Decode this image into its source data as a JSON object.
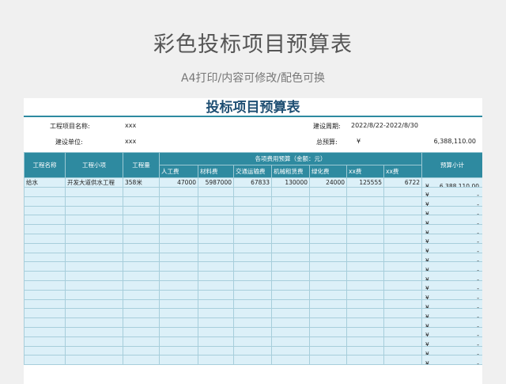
{
  "header": {
    "title": "彩色投标项目预算表",
    "subtitle": "A4打印/内容可修改/配色可换"
  },
  "sheet": {
    "title": "投标项目预算表",
    "info": {
      "project_name_label": "工程项目名称:",
      "project_name_value": "xxx",
      "period_label": "建设周期:",
      "period_value": "2022/8/22-2022/8/30",
      "unit_label": "建设单位:",
      "unit_value": "xxx",
      "total_label": "总预算:",
      "total_currency": "¥",
      "total_value": "6,388,110.00"
    },
    "table": {
      "headers": {
        "name": "工程名称",
        "item": "工程小项",
        "qty": "工程量",
        "group": "各项费用预算（金额：元）",
        "subtotal": "预算小计"
      },
      "cost_columns": [
        "人工费",
        "材料费",
        "交通运输费",
        "机械租赁费",
        "绿化费",
        "xx费",
        "xx费"
      ],
      "rows": [
        {
          "name": "给水",
          "item": "开发大道供水工程",
          "qty": "358米",
          "costs": [
            "47000",
            "5987000",
            "67833",
            "130000",
            "24000",
            "125555",
            "6722"
          ],
          "currency": "¥",
          "subtotal": "6,388,110.00"
        },
        {
          "name": "",
          "item": "",
          "qty": "",
          "costs": [
            "",
            "",
            "",
            "",
            "",
            "",
            ""
          ],
          "currency": "¥",
          "subtotal": "-"
        },
        {
          "name": "",
          "item": "",
          "qty": "",
          "costs": [
            "",
            "",
            "",
            "",
            "",
            "",
            ""
          ],
          "currency": "¥",
          "subtotal": "-"
        },
        {
          "name": "",
          "item": "",
          "qty": "",
          "costs": [
            "",
            "",
            "",
            "",
            "",
            "",
            ""
          ],
          "currency": "¥",
          "subtotal": "-"
        },
        {
          "name": "",
          "item": "",
          "qty": "",
          "costs": [
            "",
            "",
            "",
            "",
            "",
            "",
            ""
          ],
          "currency": "¥",
          "subtotal": "-"
        },
        {
          "name": "",
          "item": "",
          "qty": "",
          "costs": [
            "",
            "",
            "",
            "",
            "",
            "",
            ""
          ],
          "currency": "¥",
          "subtotal": "-"
        },
        {
          "name": "",
          "item": "",
          "qty": "",
          "costs": [
            "",
            "",
            "",
            "",
            "",
            "",
            ""
          ],
          "currency": "¥",
          "subtotal": "-"
        },
        {
          "name": "",
          "item": "",
          "qty": "",
          "costs": [
            "",
            "",
            "",
            "",
            "",
            "",
            ""
          ],
          "currency": "¥",
          "subtotal": "-"
        },
        {
          "name": "",
          "item": "",
          "qty": "",
          "costs": [
            "",
            "",
            "",
            "",
            "",
            "",
            ""
          ],
          "currency": "¥",
          "subtotal": "-"
        },
        {
          "name": "",
          "item": "",
          "qty": "",
          "costs": [
            "",
            "",
            "",
            "",
            "",
            "",
            ""
          ],
          "currency": "¥",
          "subtotal": "-"
        },
        {
          "name": "",
          "item": "",
          "qty": "",
          "costs": [
            "",
            "",
            "",
            "",
            "",
            "",
            ""
          ],
          "currency": "¥",
          "subtotal": "-"
        },
        {
          "name": "",
          "item": "",
          "qty": "",
          "costs": [
            "",
            "",
            "",
            "",
            "",
            "",
            ""
          ],
          "currency": "¥",
          "subtotal": "-"
        },
        {
          "name": "",
          "item": "",
          "qty": "",
          "costs": [
            "",
            "",
            "",
            "",
            "",
            "",
            ""
          ],
          "currency": "¥",
          "subtotal": "-"
        },
        {
          "name": "",
          "item": "",
          "qty": "",
          "costs": [
            "",
            "",
            "",
            "",
            "",
            "",
            ""
          ],
          "currency": "¥",
          "subtotal": "-"
        },
        {
          "name": "",
          "item": "",
          "qty": "",
          "costs": [
            "",
            "",
            "",
            "",
            "",
            "",
            ""
          ],
          "currency": "¥",
          "subtotal": "-"
        },
        {
          "name": "",
          "item": "",
          "qty": "",
          "costs": [
            "",
            "",
            "",
            "",
            "",
            "",
            ""
          ],
          "currency": "¥",
          "subtotal": "-"
        },
        {
          "name": "",
          "item": "",
          "qty": "",
          "costs": [
            "",
            "",
            "",
            "",
            "",
            "",
            ""
          ],
          "currency": "¥",
          "subtotal": "-"
        },
        {
          "name": "",
          "item": "",
          "qty": "",
          "costs": [
            "",
            "",
            "",
            "",
            "",
            "",
            ""
          ],
          "currency": "¥",
          "subtotal": "-"
        },
        {
          "name": "",
          "item": "",
          "qty": "",
          "costs": [
            "",
            "",
            "",
            "",
            "",
            "",
            ""
          ],
          "currency": "¥",
          "subtotal": "-"
        },
        {
          "name": "",
          "item": "",
          "qty": "",
          "costs": [
            "",
            "",
            "",
            "",
            "",
            "",
            ""
          ],
          "currency": "¥",
          "subtotal": "-"
        }
      ]
    }
  },
  "colors": {
    "header_bg": "#2e8aa0",
    "cell_bg": "#dcf0f8",
    "title_text": "#1f4f73"
  }
}
